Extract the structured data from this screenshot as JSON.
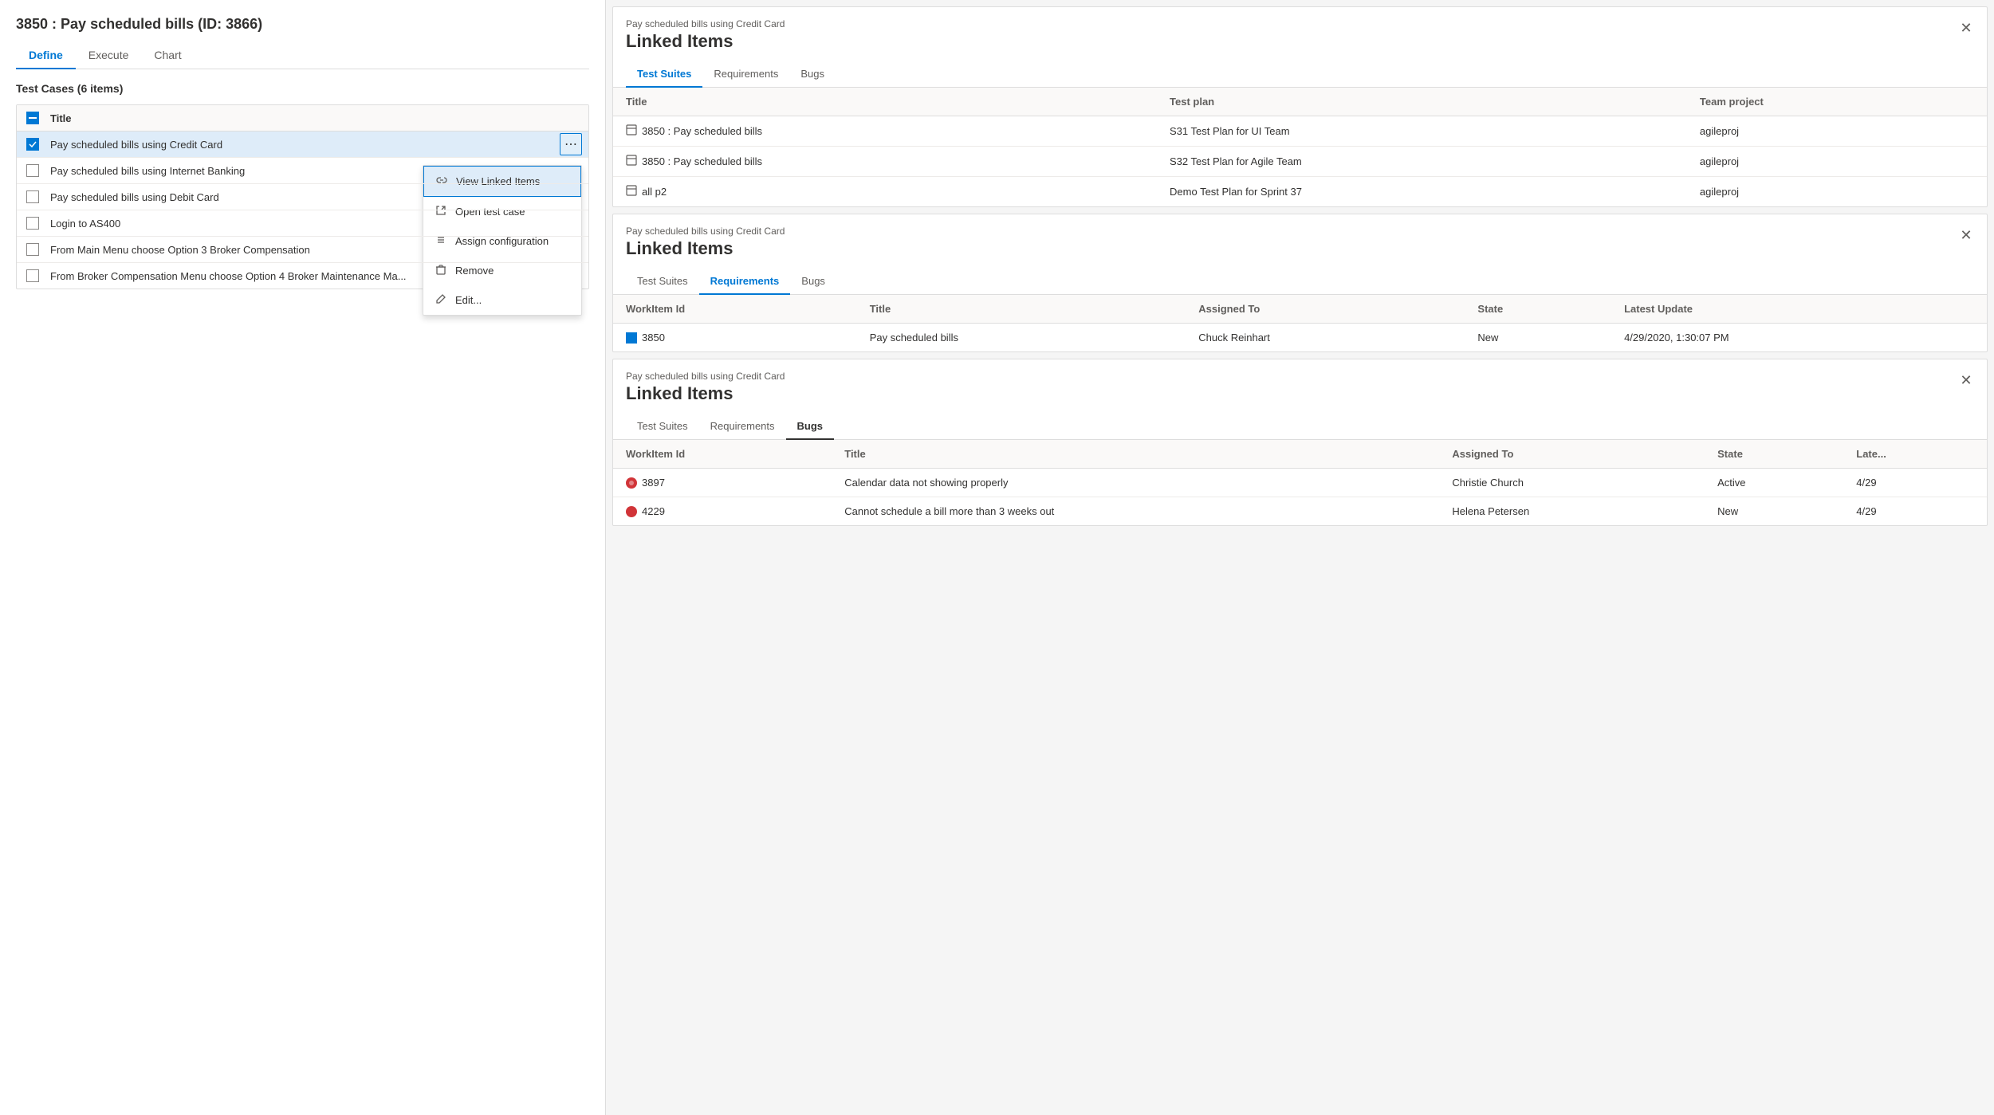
{
  "page": {
    "title": "3850 : Pay scheduled bills (ID: 3866)"
  },
  "nav": {
    "tabs": [
      {
        "label": "Define",
        "active": true
      },
      {
        "label": "Execute",
        "active": false
      },
      {
        "label": "Chart",
        "active": false
      }
    ]
  },
  "testCases": {
    "header": "Test Cases (6 items)",
    "columnTitle": "Title",
    "rows": [
      {
        "id": 1,
        "title": "Pay scheduled bills using Credit Card",
        "selected": true,
        "showMenu": true
      },
      {
        "id": 2,
        "title": "Pay scheduled bills using Internet Banking",
        "selected": false,
        "showMenu": false
      },
      {
        "id": 3,
        "title": "Pay scheduled bills using Debit Card",
        "selected": false,
        "showMenu": false
      },
      {
        "id": 4,
        "title": "Login to AS400",
        "selected": false,
        "showMenu": false
      },
      {
        "id": 5,
        "title": "From Main Menu choose Option 3 Broker Compensation",
        "selected": false,
        "showMenu": false
      },
      {
        "id": 6,
        "title": "From Broker Compensation Menu choose Option 4 Broker Maintenance Ma...",
        "selected": false,
        "showMenu": false
      }
    ]
  },
  "contextMenu": {
    "items": [
      {
        "label": "View Linked Items",
        "icon": "link",
        "highlighted": true
      },
      {
        "label": "Open test case",
        "icon": "external"
      },
      {
        "label": "Assign configuration",
        "icon": "list"
      },
      {
        "label": "Remove",
        "icon": "trash"
      },
      {
        "label": "Edit...",
        "icon": "edit"
      }
    ]
  },
  "linkedPanels": [
    {
      "subtitle": "Pay scheduled bills using Credit Card",
      "title": "Linked Items",
      "activeTab": "Test Suites",
      "tabs": [
        "Test Suites",
        "Requirements",
        "Bugs"
      ],
      "tableType": "testsuites",
      "columns": [
        "Title",
        "Test plan",
        "Team project"
      ],
      "rows": [
        {
          "col1": "3850 : Pay scheduled bills",
          "col2": "S31 Test Plan for UI Team",
          "col3": "agileproj"
        },
        {
          "col1": "3850 : Pay scheduled bills",
          "col2": "S32 Test Plan for Agile Team",
          "col3": "agileproj"
        },
        {
          "col1": "all p2",
          "col2": "Demo Test Plan for Sprint 37",
          "col3": "agileproj"
        }
      ]
    },
    {
      "subtitle": "Pay scheduled bills using Credit Card",
      "title": "Linked Items",
      "activeTab": "Requirements",
      "tabs": [
        "Test Suites",
        "Requirements",
        "Bugs"
      ],
      "tableType": "workitems",
      "columns": [
        "WorkItem Id",
        "Title",
        "Assigned To",
        "State",
        "Latest Update"
      ],
      "rows": [
        {
          "col1": "3850",
          "col2": "Pay scheduled bills",
          "col3": "Chuck Reinhart",
          "col4": "New",
          "col5": "4/29/2020, 1:30:07 PM",
          "iconType": "blue"
        }
      ]
    },
    {
      "subtitle": "Pay scheduled bills using Credit Card",
      "title": "Linked Items",
      "activeTab": "Bugs",
      "tabs": [
        "Test Suites",
        "Requirements",
        "Bugs"
      ],
      "tableType": "bugs",
      "columns": [
        "WorkItem Id",
        "Title",
        "Assigned To",
        "State",
        "Late..."
      ],
      "rows": [
        {
          "col1": "3897",
          "col2": "Calendar data not showing properly",
          "col3": "Christie Church",
          "col4": "Active",
          "col5": "4/29",
          "iconType": "red"
        },
        {
          "col1": "4229",
          "col2": "Cannot schedule a bill more than 3 weeks out",
          "col3": "Helena Petersen",
          "col4": "New",
          "col5": "4/29",
          "iconType": "red"
        }
      ]
    }
  ]
}
